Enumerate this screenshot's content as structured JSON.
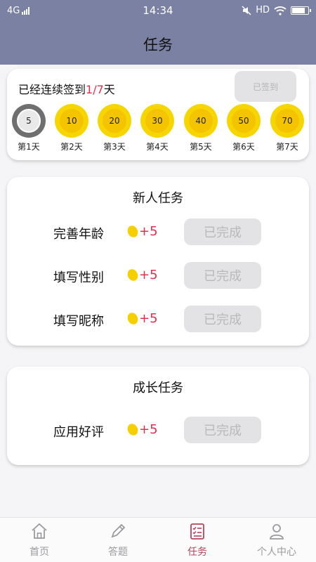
{
  "status_bar": {
    "network": "4G",
    "time": "14:34",
    "hd": "HD"
  },
  "header": {
    "title": "任务"
  },
  "signin": {
    "text_prefix": "已经连续签到",
    "progress": "1/7",
    "text_suffix": "天",
    "button_label": "已签到",
    "days": [
      {
        "value": "5",
        "label": "第1天",
        "signed": true
      },
      {
        "value": "10",
        "label": "第2天",
        "signed": false
      },
      {
        "value": "20",
        "label": "第3天",
        "signed": false
      },
      {
        "value": "30",
        "label": "第4天",
        "signed": false
      },
      {
        "value": "40",
        "label": "第5天",
        "signed": false
      },
      {
        "value": "50",
        "label": "第6天",
        "signed": false
      },
      {
        "value": "70",
        "label": "第7天",
        "signed": false
      }
    ]
  },
  "newbie_tasks": {
    "title": "新人任务",
    "items": [
      {
        "name": "完善年龄",
        "reward": "+5",
        "status": "已完成"
      },
      {
        "name": "填写性别",
        "reward": "+5",
        "status": "已完成"
      },
      {
        "name": "填写昵称",
        "reward": "+5",
        "status": "已完成"
      }
    ]
  },
  "growth_tasks": {
    "title": "成长任务",
    "items": [
      {
        "name": "应用好评",
        "reward": "+5",
        "status": "已完成"
      }
    ]
  },
  "tabbar": {
    "items": [
      {
        "label": "首页",
        "icon": "home-icon",
        "active": false
      },
      {
        "label": "答题",
        "icon": "pencil-icon",
        "active": false
      },
      {
        "label": "任务",
        "icon": "task-list-icon",
        "active": true
      },
      {
        "label": "个人中心",
        "icon": "user-icon",
        "active": false
      }
    ]
  },
  "colors": {
    "header_bg": "#7b81a3",
    "accent": "#e0304c",
    "active_tab": "#b8435c",
    "coin": "#f7d500"
  }
}
